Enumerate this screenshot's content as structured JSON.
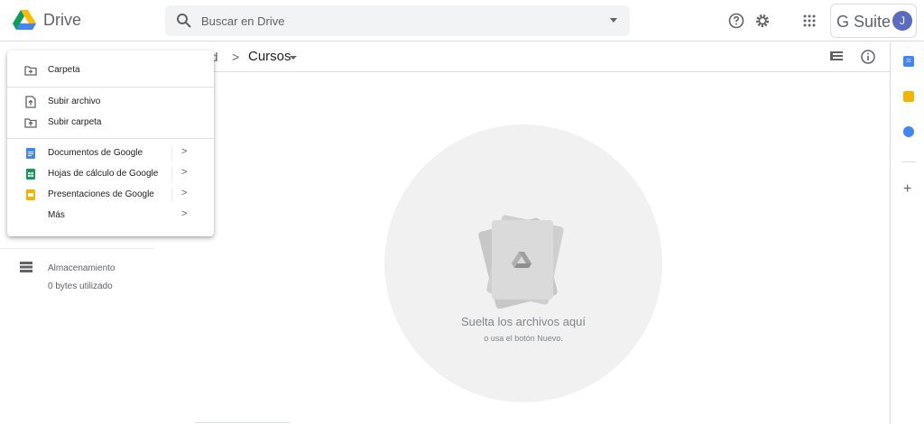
{
  "header": {
    "app_name": "Drive",
    "search_placeholder": "Buscar en Drive",
    "brand": "G Suite",
    "avatar_letter": "J"
  },
  "breadcrumb": {
    "previous": "ad",
    "separator": ">",
    "current": "Cursos"
  },
  "storage": {
    "label": "Almacenamiento",
    "used": "0 bytes utilizado"
  },
  "dropzone": {
    "title": "Suelta los archivos aquí",
    "subtitle": "o usa el botón Nuevo."
  },
  "new_menu": {
    "items": [
      {
        "label": "Carpeta",
        "icon": "folder-add-icon"
      },
      {
        "label": "Subir archivo",
        "icon": "file-upload-icon"
      },
      {
        "label": "Subir carpeta",
        "icon": "folder-upload-icon"
      },
      {
        "label": "Documentos de Google",
        "icon": "google-docs-icon",
        "has_submenu": true
      },
      {
        "label": "Hojas de cálculo de Google",
        "icon": "google-sheets-icon",
        "has_submenu": true
      },
      {
        "label": "Presentaciones de Google",
        "icon": "google-slides-icon",
        "has_submenu": true
      },
      {
        "label": "Más",
        "has_submenu": true
      }
    ],
    "submenu_arrow": ">"
  },
  "side_panel": {
    "calendar_label": "31"
  },
  "colors": {
    "docs": "#4285f4",
    "sheets": "#0f9d58",
    "slides": "#f4b400",
    "avatar": "#5c6bc0"
  }
}
